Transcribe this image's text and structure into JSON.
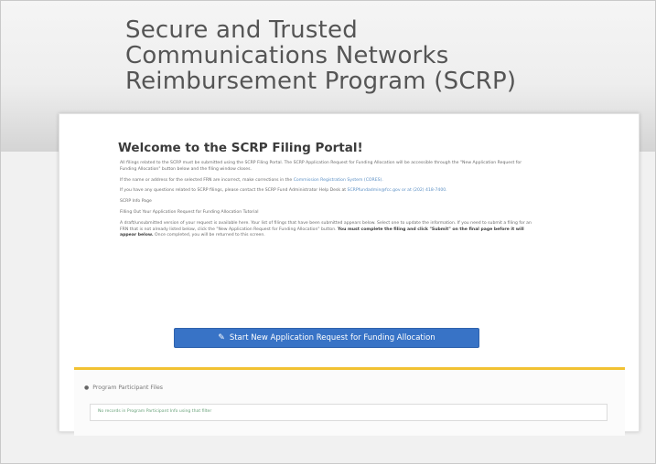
{
  "header": {
    "title_lines": [
      "Secure and Trusted",
      "Communications Networks",
      "Reimbursement Program (SCRP)"
    ]
  },
  "welcome": {
    "heading": "Welcome to the SCRP Filing Portal!",
    "p1": "All filings related to the SCRP must be submitted using the SCRP Filing Portal. The SCRP Application Request for Funding Allocation will be accessible through the \"New Application Request for Funding Allocation\" button below and the filing window closes.",
    "p2_text": "If the name or address for the selected FRN are incorrect, make corrections in the ",
    "p2_link": "Commission Registration System (CORES).",
    "p3_text": "If you have any questions related to SCRP filings, please contact the SCRP Fund Administrator Help Desk at ",
    "p3_link": "SCRPfundadmin@fcc.gov or at (202) 418-7400.",
    "p4": "SCRP Info Page",
    "p5": "Filling Out Your Application Request for Funding Allocation Tutorial",
    "p6_text": "A draft/unsubmitted version of your request is available here. Your list of filings that have been submitted appears below. Select one to update the information. If you need to submit a filing for an FRN that is not already listed below, click the \"New Application Request for Funding Allocation\" button. ",
    "p6_bold": "You must complete the filing and click \"Submit\" on the final page before it will appear below.",
    "p6_tail": " Once completed, you will be returned to this screen."
  },
  "actions": {
    "start_label": "Start New Application Request for Funding Allocation"
  },
  "files": {
    "heading": "Program Participant Files",
    "empty_text": "No records in Program Participant Info using that filter"
  },
  "colors": {
    "primary_button": "#3873c6",
    "panel_accent": "#f2c232",
    "link": "#5b8fc4"
  },
  "icons": {
    "start": "pencil-icon",
    "files": "user-icon"
  }
}
